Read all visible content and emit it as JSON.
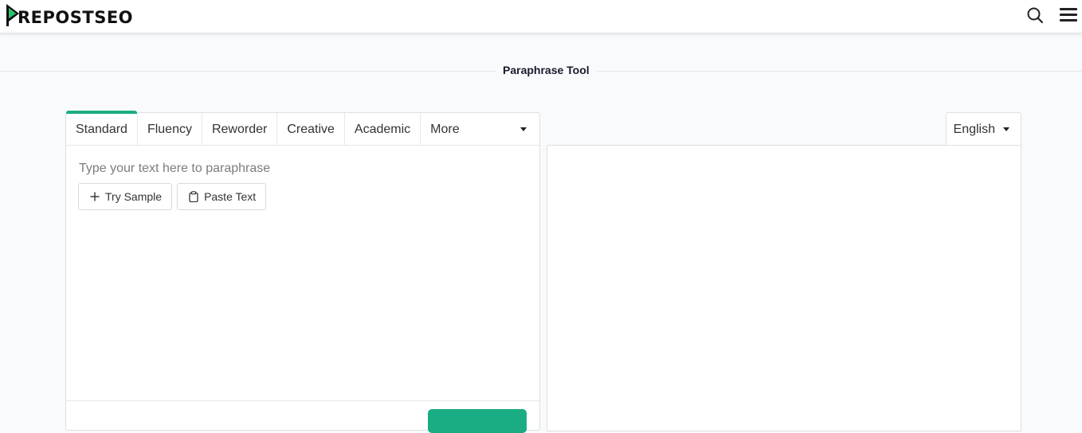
{
  "brand": {
    "name": "REPOSTSEO",
    "accent": "#1aac83"
  },
  "header": {
    "search_icon": "search-icon",
    "menu_icon": "hamburger-menu-icon"
  },
  "page": {
    "title": "Paraphrase Tool"
  },
  "modes": {
    "tabs": [
      {
        "label": "Standard",
        "active": true
      },
      {
        "label": "Fluency",
        "active": false
      },
      {
        "label": "Reworder",
        "active": false
      },
      {
        "label": "Creative",
        "active": false
      },
      {
        "label": "Academic",
        "active": false
      }
    ],
    "more_label": "More"
  },
  "input": {
    "placeholder": "Type your text here to paraphrase",
    "value": ""
  },
  "actions": {
    "try_sample": "Try Sample",
    "paste_text": "Paste Text"
  },
  "output": {
    "language": "English"
  }
}
